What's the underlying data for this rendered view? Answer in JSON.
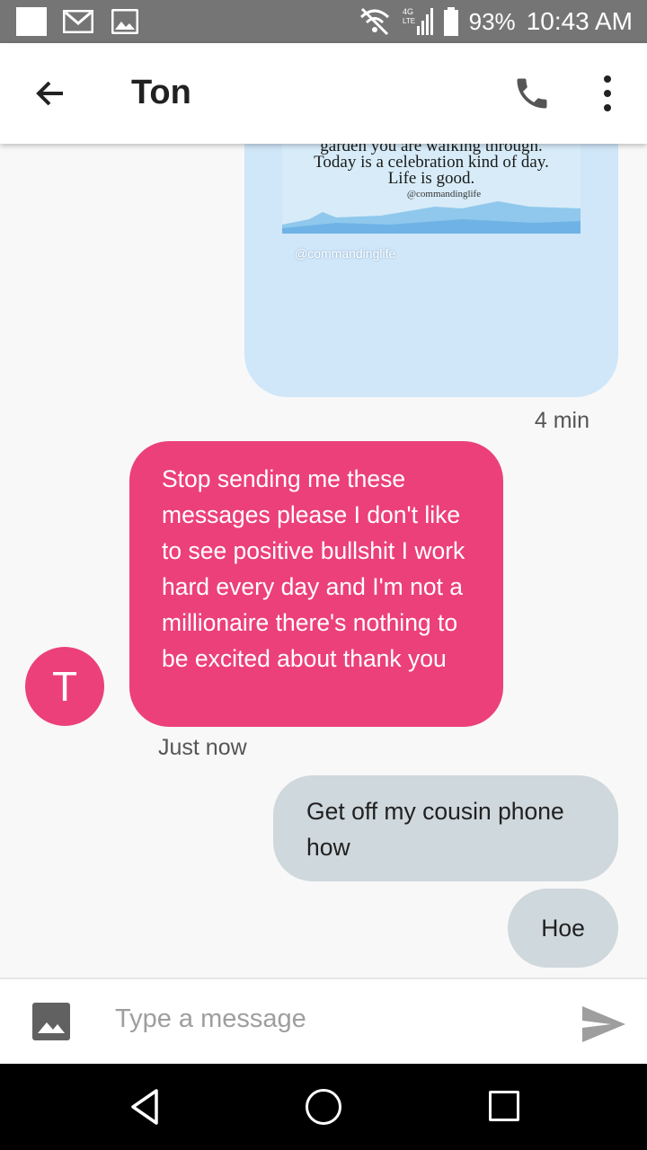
{
  "status_bar": {
    "network": "4G LTE",
    "battery": "93%",
    "time": "10:43 AM"
  },
  "header": {
    "title": "Ton"
  },
  "messages": {
    "image_quote_lines": [
      "garden you are walking through.",
      "Today is a celebration kind of day.",
      "Life is good."
    ],
    "image_quote_handle": "@commandinglife",
    "image_footer": "@commandinglife",
    "image_time": "4 min",
    "avatar_letter": "T",
    "incoming_text": "Stop sending me these messages please I don't like to see positive bullshit I work hard every day and I'm not a millionaire there's nothing to be excited about thank you",
    "incoming_time": "Just now",
    "outgoing_1": "Get off my cousin phone how",
    "outgoing_2": "Hoe"
  },
  "compose": {
    "placeholder": "Type a message"
  },
  "colors": {
    "incoming_bubble": "#ec407a",
    "outgoing_bubble": "#cfd8dc",
    "image_bubble": "#d0e6f9"
  }
}
